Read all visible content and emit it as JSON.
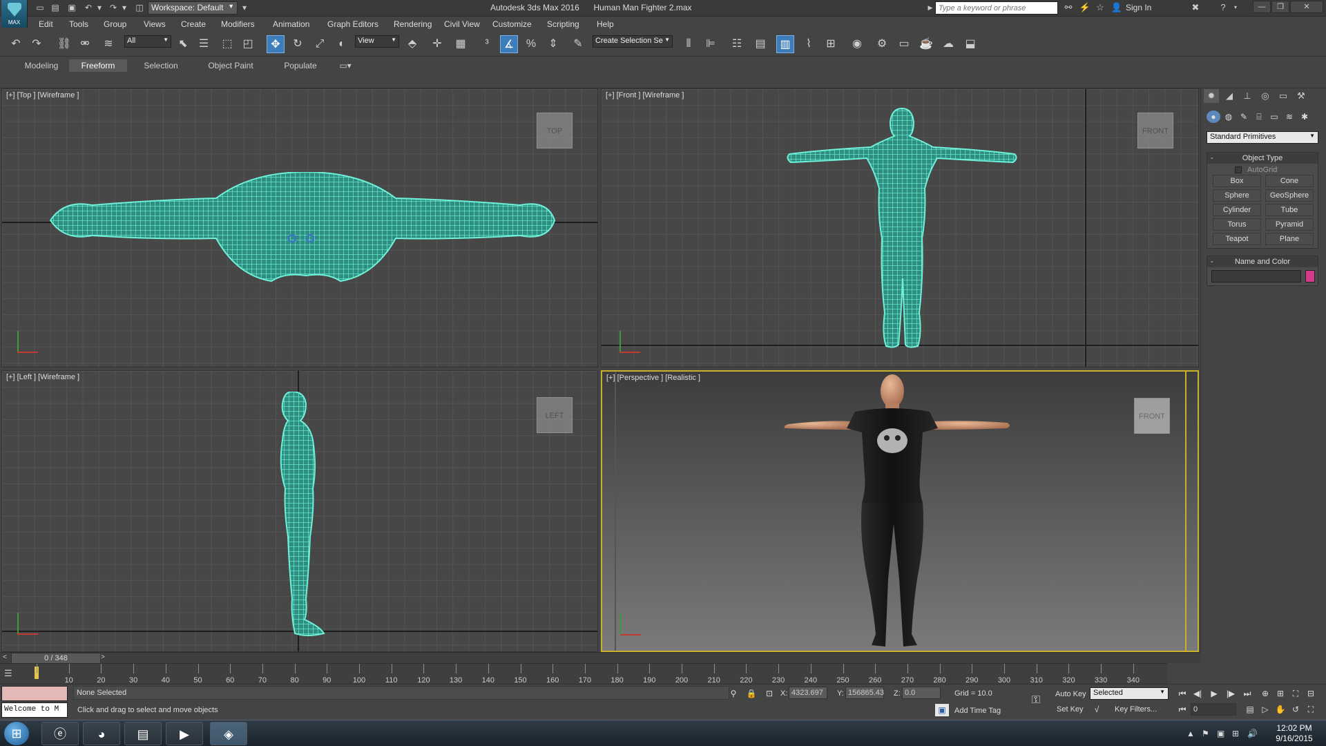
{
  "titlebar": {
    "app_badge": "MAX",
    "workspace": "Workspace: Default",
    "app_name": "Autodesk 3ds Max 2016",
    "file_name": "Human Man Fighter 2.max",
    "search_placeholder": "Type a keyword or phrase",
    "sign_in": "Sign In"
  },
  "menubar": [
    "Edit",
    "Tools",
    "Group",
    "Views",
    "Create",
    "Modifiers",
    "Animation",
    "Graph Editors",
    "Rendering",
    "Civil View",
    "Customize",
    "Scripting",
    "Help"
  ],
  "toolbar": {
    "selection_filter": "All",
    "ref_coord": "View",
    "named_selection": "Create Selection Se"
  },
  "ribbon": {
    "tabs": [
      "Modeling",
      "Freeform",
      "Selection",
      "Object Paint",
      "Populate"
    ],
    "active_tab": "Freeform"
  },
  "viewports": {
    "top": {
      "label": "[+] [Top ] [Wireframe ]",
      "cube": "TOP"
    },
    "front": {
      "label": "[+] [Front ] [Wireframe ]",
      "cube": "FRONT"
    },
    "left": {
      "label": "[+] [Left ] [Wireframe ]",
      "cube": "LEFT"
    },
    "perspective": {
      "label": "[+] [Perspective ] [Realistic ]",
      "cube": "FRONT"
    },
    "wire_color": "#4fd9c0",
    "active_border": "#c9b12a"
  },
  "command_panel": {
    "dropdown": "Standard Primitives",
    "object_type_title": "Object Type",
    "autogrid": "AutoGrid",
    "buttons": [
      "Box",
      "Cone",
      "Sphere",
      "GeoSphere",
      "Cylinder",
      "Tube",
      "Torus",
      "Pyramid",
      "Teapot",
      "Plane"
    ],
    "name_color_title": "Name and Color",
    "swatch_color": "#d43a8a"
  },
  "timeline": {
    "frame_readout": "0 / 348",
    "prev": "<",
    "next": ">",
    "ticks": [
      "10",
      "20",
      "30",
      "40",
      "50",
      "60",
      "70",
      "80",
      "90",
      "100",
      "110",
      "120",
      "130",
      "140",
      "150",
      "160",
      "170",
      "180",
      "190",
      "200",
      "210",
      "220",
      "230",
      "240",
      "250",
      "260",
      "270",
      "280",
      "290",
      "300",
      "310",
      "320",
      "330",
      "340"
    ]
  },
  "status": {
    "welcome": "Welcome to M",
    "selection": "None Selected",
    "prompt": "Click and drag to select and move objects",
    "x_label": "X:",
    "x_value": "4323.697",
    "y_label": "Y:",
    "y_value": "156865.43",
    "z_label": "Z:",
    "z_value": "0.0",
    "grid": "Grid = 10.0",
    "add_time_tag": "Add Time Tag",
    "auto_key": "Auto Key",
    "set_key": "Set Key",
    "selected_dd": "Selected",
    "key_filters": "Key Filters...",
    "frame_value": "0"
  },
  "taskbar": {
    "time": "12:02 PM",
    "date": "9/16/2015"
  }
}
